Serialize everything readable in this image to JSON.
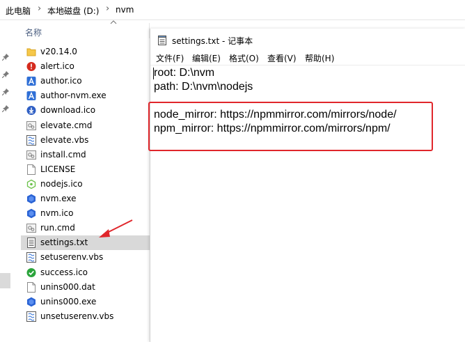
{
  "breadcrumb": {
    "items": [
      "此电脑",
      "本地磁盘 (D:)",
      "nvm"
    ],
    "separator": "›"
  },
  "columns": {
    "name_label": "名称"
  },
  "files": [
    {
      "name": "v20.14.0",
      "icon": "folder-icon"
    },
    {
      "name": "alert.ico",
      "icon": "alert-icon"
    },
    {
      "name": "author.ico",
      "icon": "author-icon"
    },
    {
      "name": "author-nvm.exe",
      "icon": "author-icon"
    },
    {
      "name": "download.ico",
      "icon": "download-icon"
    },
    {
      "name": "elevate.cmd",
      "icon": "cmd-icon"
    },
    {
      "name": "elevate.vbs",
      "icon": "vbs-icon"
    },
    {
      "name": "install.cmd",
      "icon": "cmd-icon"
    },
    {
      "name": "LICENSE",
      "icon": "file-icon"
    },
    {
      "name": "nodejs.ico",
      "icon": "nodejs-icon"
    },
    {
      "name": "nvm.exe",
      "icon": "nvm-icon"
    },
    {
      "name": "nvm.ico",
      "icon": "nvm-icon"
    },
    {
      "name": "run.cmd",
      "icon": "cmd-icon"
    },
    {
      "name": "settings.txt",
      "icon": "text-file-icon",
      "selected": true
    },
    {
      "name": "setuserenv.vbs",
      "icon": "vbs-icon"
    },
    {
      "name": "success.ico",
      "icon": "success-icon"
    },
    {
      "name": "unins000.dat",
      "icon": "file-icon"
    },
    {
      "name": "unins000.exe",
      "icon": "nvm-icon"
    },
    {
      "name": "unsetuserenv.vbs",
      "icon": "vbs-icon"
    }
  ],
  "notepad": {
    "title": "settings.txt - 记事本",
    "menu": [
      "文件(F)",
      "编辑(E)",
      "格式(O)",
      "查看(V)",
      "帮助(H)"
    ],
    "lines": [
      "root: D:\\nvm",
      "path: D:\\nvm\\nodejs",
      "",
      "node_mirror: https://npmmirror.com/mirrors/node/",
      "npm_mirror: https://npmmirror.com/mirrors/npm/"
    ]
  },
  "colors": {
    "highlight": "#e0262b",
    "selected_row": "#d9d9d9",
    "header_text": "#4d6082"
  }
}
